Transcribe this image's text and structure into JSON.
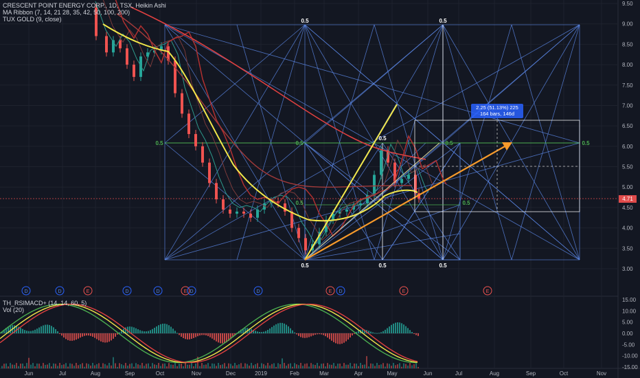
{
  "legend": {
    "symbol_line": "CRESCENT POINT ENERGY CORP., 1D, TSX, Heikin Ashi",
    "ma_ribbon": "MA Ribbon (7, 14, 21 28, 35, 42, 50, 100, 200)",
    "tux_gold": "TUX GOLD (9, close)",
    "macd_title": "TH_RSIMACD+ (14, 14, 60, 5)",
    "vol": "Vol (20)"
  },
  "price_axis": [
    "9.50",
    "9.00",
    "8.50",
    "8.00",
    "7.50",
    "7.00",
    "6.50",
    "6.00",
    "5.50",
    "5.00",
    "4.50",
    "4.00",
    "3.50",
    "3.00"
  ],
  "current_price": "4.71",
  "macd_axis": [
    "15.00",
    "10.00",
    "5.00",
    "0.00",
    "-5.00",
    "-10.00",
    "-15.00"
  ],
  "time_axis": [
    "Jun",
    "Jul",
    "Aug",
    "Sep",
    "Oct",
    "Nov",
    "Dec",
    "2019",
    "Feb",
    "Mar",
    "Apr",
    "May",
    "Jun",
    "Jul",
    "Aug",
    "Sep",
    "Oct",
    "Nov"
  ],
  "fib_labels": {
    "top_left": "0.5",
    "top_right": "0.5",
    "left_mid": "0.5",
    "center_mid": "0.5",
    "right_mid_a": "0.5",
    "right_mid_b": "0.5",
    "inner_a": "0.5",
    "inner_b": "0.5",
    "bottom_left": "0.5",
    "bottom_mid": "0.5",
    "bottom_right": "0.5",
    "top_small": "0.5"
  },
  "measure": {
    "line1": "2.25 (51.13%) 225",
    "line2": "164 bars, 146d"
  },
  "events": [
    "D",
    "D",
    "E",
    "D",
    "D",
    "E",
    "D",
    "E",
    "D",
    "E",
    "D"
  ],
  "colors": {
    "background": "#131722",
    "grid": "#1e222d",
    "fib_blue": "#5b87e6",
    "fib_green": "#4caf50",
    "yellow": "#f3e84a",
    "orange": "#f79a2b",
    "red_line": "#e04040",
    "up_candle": "#26a69a",
    "down_candle": "#ef5350",
    "price_tag": "#e04b4b"
  }
}
